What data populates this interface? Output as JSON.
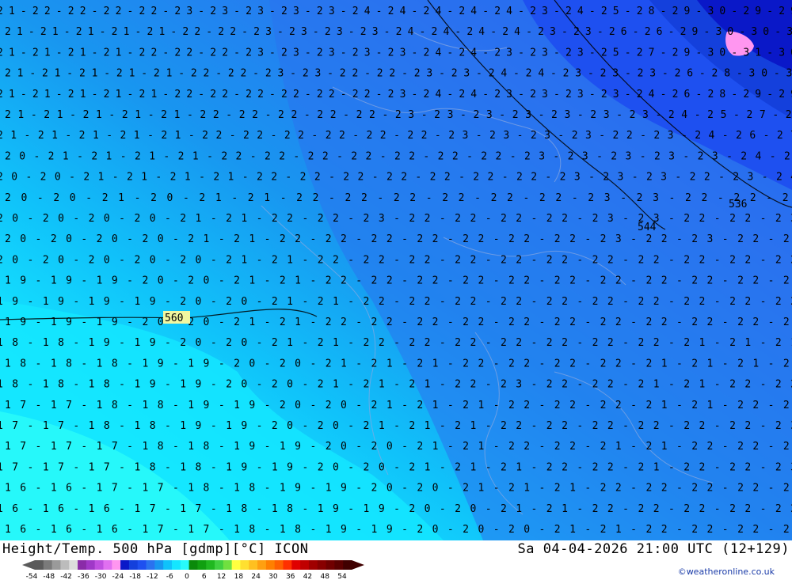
{
  "map": {
    "row_labels": [
      "21-22-22-22-22-23-23-23-23-23-24-24-24-24-24-23-24-25-28-29-30-29-29",
      "21-21-21-21-21-22-22-23-23-23-23-24-24-24-24-23-23-26-26-29-30-30-30",
      "21-21-21-21-22-22-22-23-23-23-23-23-24-24-23-23-23-25-27-29-30-31-30",
      "21-21-21-21-21-22-22-23-23-22-22-23-23-24-24-23-23-23-26-28-30-30",
      "21-21-21-21-21-22-22-22-22-22-22-23-24-24-23-23-23-23-24-26-28-29-29",
      "21-21-21-21-21-22-22-22-22-22-23-23-23-23-23-23-23-24-25-27-28",
      "21-21-21-21-21-22-22-22-22-22-22-23-23-23-23-22-23-24-26-27",
      "20-21-21-21-21-22-22-22-22-22-22-22-23-23-23-23-23-24-26",
      "20-20-21-21-21-21-22-22-22-22-22-22-22-23-23-23-22-23-24",
      "20-20-21-20-21-21-22-22-22-22-22-22-23-23-22-22-23",
      "20-20-20-20-21-21-22-22-23-22-22-22-22-23-23-22-22-23",
      "20-20-20-20-21-21-22-22-22-22-22-22-22-23-22-23-22-22",
      "20-20-20-20-20-21-21-22-22-22-22-22-22-22-22-22-22-22",
      "19-19-19-20-20-21-21-22-22-22-22-22-22-22-22-22-22-22",
      "19-19-19-19-20-20-21-21-22-22-22-22-22-22-22-22-22-22",
      "19-19-19-20-20-21-21-22-22-22-22-22-22-22-22-22-22-22",
      "18-18-19-19-20-20-21-21-22-22-22-22-22-22-22-21-21-21",
      "18-18-18-19-19-20-20-21-21-21-22-22-22-22-21-21-21-22",
      "18-18-18-19-19-20-20-21-21-21-22-23-22-22-21-21-22-22",
      "17-17-18-18-19-19-20-20-21-21-21-22-22-22-21-21-22-22",
      "17-17-18-18-19-19-20-20-21-21-21-22-22-22-22-22-22-23",
      "17-17-17-18-18-19-19-20-20-21-21-22-22-21-21-22-22-23",
      "17-17-17-18-18-19-19-20-20-21-21-21-22-22-21-22-22-23",
      "16-16-17-17-18-18-19-19-20-20-21-21-21-22-22-22-22-23",
      "16-16-16-17-17-18-18-19-19-20-20-21-21-22-22-22-22-22",
      "16-16-16-17-17-18-18-19-19-20-20-20-21-21-22-22-22-22"
    ],
    "contour_labels": [
      "560",
      "544",
      "536"
    ],
    "colors": {
      "t_minus16": "#28fafa",
      "t_minus18": "#14e6ff",
      "t_minus20": "#10c2fa",
      "t_minus22": "#1896f0",
      "t_minus24": "#2a72ef",
      "t_minus26": "#1e50f0",
      "t_minus28": "#1440dc",
      "t_minus30": "#0a18c8",
      "t_minus32": "#ff96f0"
    }
  },
  "footer": {
    "title_left": "Height/Temp. 500 hPa [gdmp][°C] ICON",
    "title_right": "Sa 04-04-2026 21:00 UTC (12+129)",
    "credit": "©weatheronline.co.uk",
    "scale_ticks": [
      "-54",
      "-48",
      "-42",
      "-36",
      "-30",
      "-24",
      "-18",
      "-12",
      "-6",
      "0",
      "6",
      "12",
      "18",
      "24",
      "30",
      "36",
      "42",
      "48",
      "54"
    ],
    "scale_colors": [
      "#5a5a5a",
      "#7a7a7a",
      "#9a9a9a",
      "#bcbcbc",
      "#dcdcdc",
      "#8a2ba8",
      "#a038c8",
      "#c050e0",
      "#e070f0",
      "#ff96f0",
      "#0a18c8",
      "#1440dc",
      "#1e50f0",
      "#2a72ef",
      "#1896f0",
      "#10c2fa",
      "#14e6ff",
      "#28fafa",
      "#0a8a0a",
      "#10a010",
      "#20b820",
      "#40d040",
      "#70e040",
      "#ffff40",
      "#ffe030",
      "#ffc020",
      "#ffa010",
      "#ff8000",
      "#ff6000",
      "#ff3000",
      "#e00000",
      "#c00000",
      "#a00000",
      "#880000",
      "#700000",
      "#5a0000",
      "#400000"
    ]
  }
}
